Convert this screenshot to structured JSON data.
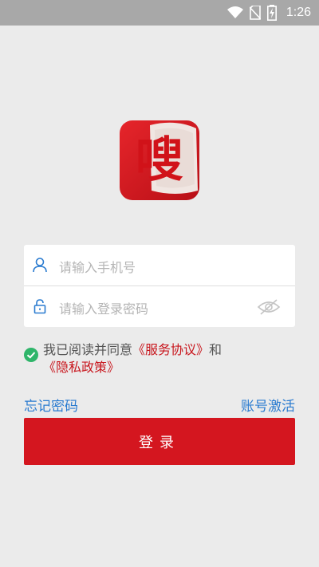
{
  "status_bar": {
    "time": "1:26"
  },
  "logo": {
    "glyph": "嗖",
    "color": "#cf1219"
  },
  "login_form": {
    "phone_placeholder": "请输入手机号",
    "password_placeholder": "请输入登录密码"
  },
  "agreement": {
    "prefix": "我已阅读并同意",
    "service_link": "《服务协议》",
    "connector": "和",
    "privacy_link": "《隐私政策》"
  },
  "links": {
    "forgot_password": "忘记密码",
    "activate_account": "账号激活"
  },
  "login_button": {
    "label": "登录"
  },
  "colors": {
    "accent": "#d4161f",
    "link_blue": "#2a7bd0",
    "check_green": "#2fb56a"
  }
}
